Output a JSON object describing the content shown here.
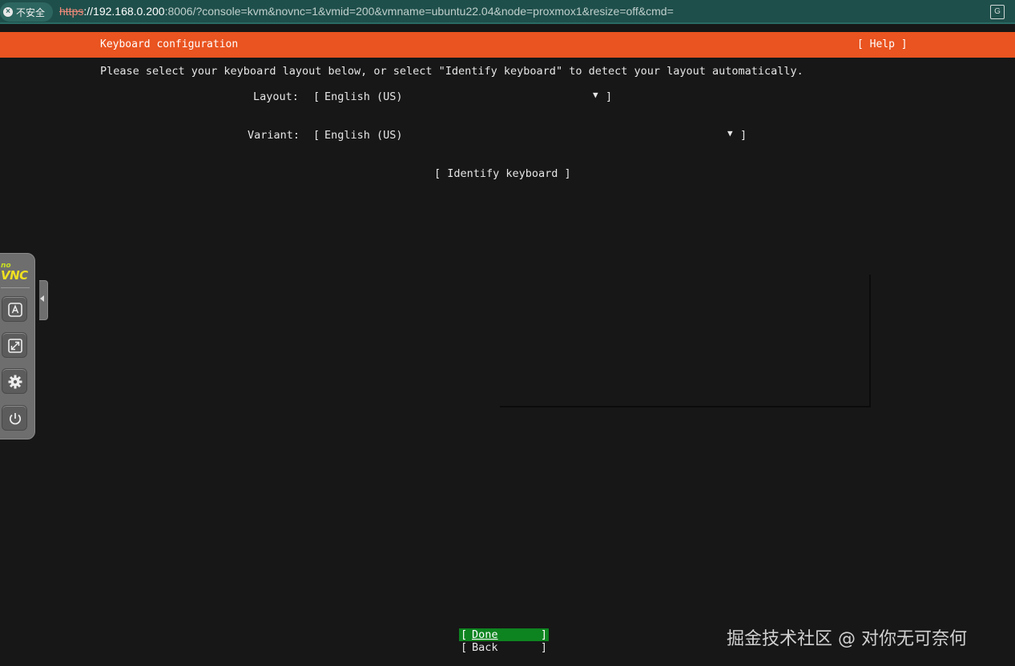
{
  "browser": {
    "insecure_label": "不安全",
    "url_scheme": "https",
    "url_host": "://192.168.0.200",
    "url_rest": ":8006/?console=kvm&novnc=1&vmid=200&vmname=ubuntu22.04&node=proxmox1&resize=off&cmd=",
    "translate_icon": "translate-icon"
  },
  "header": {
    "title": "Keyboard configuration",
    "help": "[ Help ]"
  },
  "instructions": "Please select your keyboard layout below, or select \"Identify keyboard\" to detect your layout automatically.",
  "layout": {
    "label": "Layout:",
    "open": "[",
    "value": "English (US)",
    "arrow": "▼",
    "close": "]"
  },
  "variant": {
    "label": "Variant:",
    "open": "[",
    "value": "English (US)",
    "arrow": "▼",
    "close": "]"
  },
  "identify_button": "[ Identify keyboard ]",
  "buttons": {
    "done": {
      "open": "[",
      "label": "Done",
      "close": "]"
    },
    "back": {
      "open": "[",
      "label": "Back",
      "close": "]"
    }
  },
  "novnc": {
    "logo_top": "no",
    "logo_main": "VNC",
    "buttons": [
      "keyboard-icon",
      "fullscreen-icon",
      "gear-icon",
      "power-icon"
    ]
  },
  "colors": {
    "header_bg": "#e95420",
    "done_bg": "#0e8420",
    "terminal_bg": "#171717"
  },
  "watermark": "掘金技术社区 @ 对你无可奈何"
}
